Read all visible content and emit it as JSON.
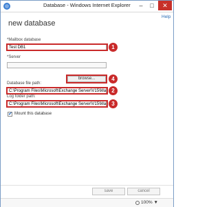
{
  "window": {
    "title": "Database - Windows Internet Explorer",
    "minimize_glyph": "–",
    "maximize_glyph": "□",
    "close_glyph": "✕"
  },
  "dialog": {
    "help_link": "Help",
    "title": "new database"
  },
  "form": {
    "mailbox_db_label": "*Mailbox database",
    "mailbox_db_value": "Test DB1",
    "server_label": "*Server",
    "browse_label": "browse...",
    "db_path_label": "Database file path:",
    "db_path_value": "C:\\Program Files\\Microsoft\\Exchange Server\\V15\\Mailbo",
    "log_path_label": "Log folder path:",
    "log_path_value": "C:\\Program Files\\Microsoft\\Exchange Server\\V15\\Mailbo",
    "mount_label": "Mount this database",
    "mount_checked": true,
    "mount_check_glyph": "✔"
  },
  "callouts": [
    "1",
    "2",
    "3",
    "4"
  ],
  "buttons": {
    "save": "save",
    "cancel": "cancel"
  },
  "status": {
    "zoom": "100%",
    "zoom_caret": "▼"
  },
  "colors": {
    "highlight": "#c92a2a",
    "close_button": "#c7302a",
    "link": "#2a6db5"
  },
  "icons": [
    "internet-explorer-icon",
    "minimize-icon",
    "maximize-icon",
    "close-icon",
    "checkmark-icon",
    "zoom-icon"
  ]
}
